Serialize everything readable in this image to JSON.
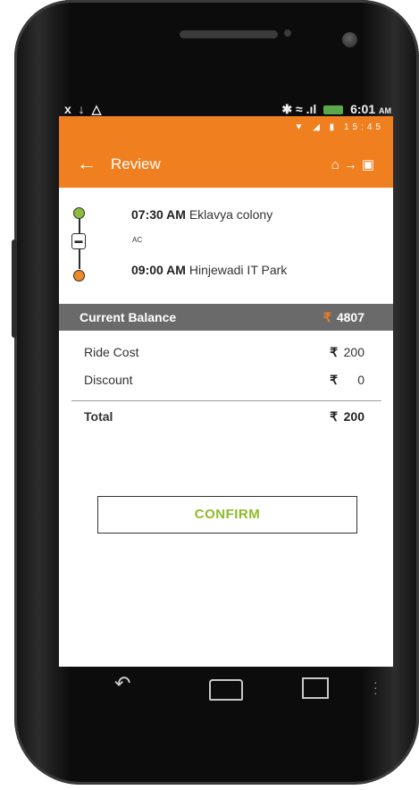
{
  "outer_status": {
    "left_icons": "x ↓ △",
    "right_icons": "✱ ≈ .ıl",
    "time": "6:01",
    "ampm": "AM"
  },
  "app_status": {
    "icons": "▼ ◢ ▮",
    "time": "15:45"
  },
  "app_bar": {
    "title": "Review",
    "back_icon": "arrow-left-icon",
    "action_icons": [
      "home-icon",
      "arrow-right-icon",
      "bus-icon"
    ]
  },
  "route": {
    "start_time": "07:30 AM",
    "start_place": "Eklavya colony",
    "vehicle_type": "AC",
    "end_time": "09:00 AM",
    "end_place": "Hinjewadi IT Park",
    "colors": {
      "start": "#8dbd3c",
      "end": "#ee8a23"
    }
  },
  "balance": {
    "label": "Current Balance",
    "currency": "₹",
    "value": "4807"
  },
  "fare": {
    "ride_cost_label": "Ride Cost",
    "ride_cost_currency": "₹",
    "ride_cost_value": "200",
    "discount_label": "Discount",
    "discount_currency": "₹",
    "discount_value": "0",
    "total_label": "Total",
    "total_currency": "₹",
    "total_value": "200"
  },
  "confirm_label": "CONFIRM",
  "colors": {
    "accent": "#f07f1f",
    "confirm_text": "#8dbb2a",
    "balance_bar": "#6a6a6a"
  }
}
